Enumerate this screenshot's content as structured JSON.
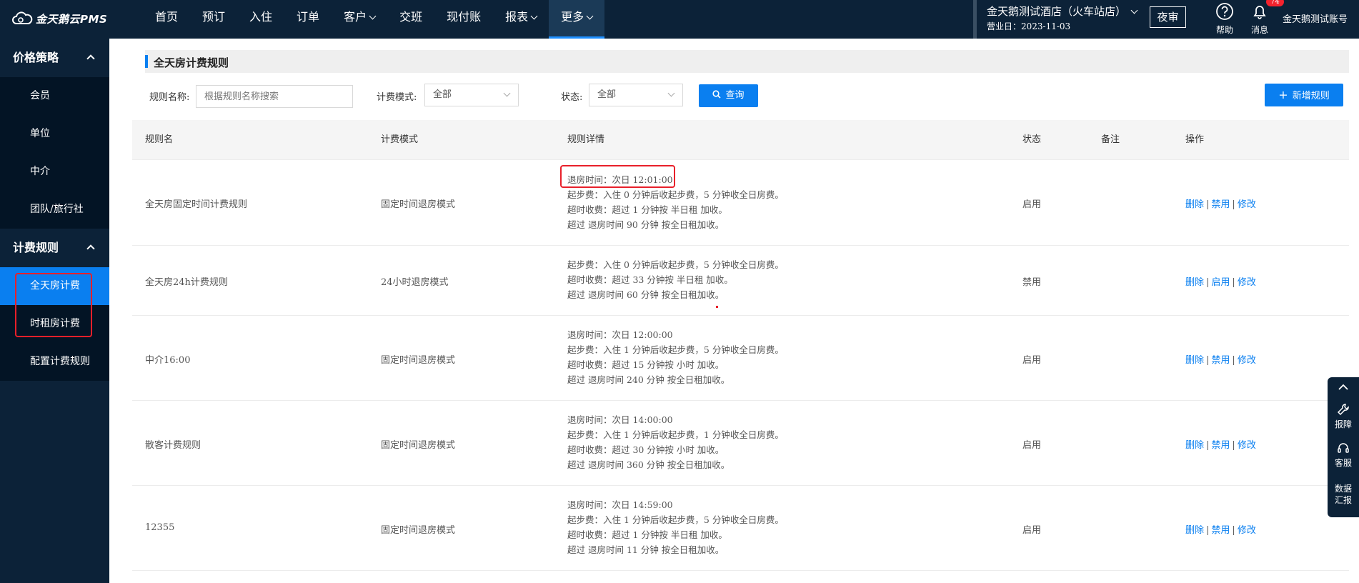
{
  "app": {
    "logo_text": "金天鹅云PMS"
  },
  "nav": {
    "items": [
      {
        "label": "首页",
        "dropdown": false,
        "active": false
      },
      {
        "label": "预订",
        "dropdown": false,
        "active": false
      },
      {
        "label": "入住",
        "dropdown": false,
        "active": false
      },
      {
        "label": "订单",
        "dropdown": false,
        "active": false
      },
      {
        "label": "客户",
        "dropdown": true,
        "active": false
      },
      {
        "label": "交班",
        "dropdown": false,
        "active": false
      },
      {
        "label": "现付账",
        "dropdown": false,
        "active": false
      },
      {
        "label": "报表",
        "dropdown": true,
        "active": false
      },
      {
        "label": "更多",
        "dropdown": true,
        "active": true
      }
    ]
  },
  "header": {
    "hotel_name": "金天鹅测试酒店（火车站店）",
    "business_date": "营业日：2023-11-03",
    "night_audit": "夜审",
    "help": "帮助",
    "messages": "消息",
    "message_badge": "74",
    "user": "金天鹅测试账号"
  },
  "sidebar": {
    "group1": "价格策略",
    "group1_items": [
      "会员",
      "单位",
      "中介",
      "团队/旅行社"
    ],
    "group2": "计费规则",
    "group2_items": [
      "全天房计费",
      "时租房计费",
      "配置计费规则"
    ],
    "active_item": "全天房计费"
  },
  "page": {
    "title": "全天房计费规则"
  },
  "filters": {
    "name_label": "规则名称:",
    "name_placeholder": "根据规则名称搜索",
    "mode_label": "计费模式:",
    "mode_value": "全部",
    "status_label": "状态:",
    "status_value": "全部",
    "query_button": "查询",
    "add_button": "新增规则"
  },
  "table": {
    "columns": [
      "规则名",
      "计费模式",
      "规则详情",
      "状态",
      "备注",
      "操作"
    ],
    "rows": [
      {
        "name": "全天房固定时间计费规则",
        "mode": "固定时间退房模式",
        "details": [
          "退房时间：次日 12:01:00",
          "起步费：入住 0 分钟后收起步费，5 分钟收全日房费。",
          "超时收费：超过 1 分钟按 半日租 加收。",
          "超过 退房时间 90 分钟 按全日租加收。"
        ],
        "status": "启用",
        "note": "",
        "ops": [
          "删除",
          "禁用",
          "修改"
        ]
      },
      {
        "name": "全天房24h计费规则",
        "mode": "24小时退房模式",
        "details": [
          "起步费：入住 0 分钟后收起步费，5 分钟收全日房费。",
          "超时收费：超过 33 分钟按 半日租 加收。",
          "超过 退房时间 60 分钟 按全日租加收。"
        ],
        "status": "禁用",
        "note": "",
        "ops": [
          "删除",
          "启用",
          "修改"
        ]
      },
      {
        "name": "中介16:00",
        "mode": "固定时间退房模式",
        "details": [
          "退房时间：次日 12:00:00",
          "起步费：入住 1 分钟后收起步费，5 分钟收全日房费。",
          "超时收费：超过 15 分钟按 小时 加收。",
          "超过 退房时间 240 分钟 按全日租加收。"
        ],
        "status": "启用",
        "note": "",
        "ops": [
          "删除",
          "禁用",
          "修改"
        ]
      },
      {
        "name": "散客计费规则",
        "mode": "固定时间退房模式",
        "details": [
          "退房时间：次日 14:00:00",
          "起步费：入住 1 分钟后收起步费，1 分钟收全日房费。",
          "超时收费：超过 30 分钟按 小时 加收。",
          "超过 退房时间 360 分钟 按全日租加收。"
        ],
        "status": "启用",
        "note": "",
        "ops": [
          "删除",
          "禁用",
          "修改"
        ]
      },
      {
        "name": "12355",
        "mode": "固定时间退房模式",
        "details": [
          "退房时间：次日 14:59:00",
          "起步费：入住 1 分钟后收起步费，5 分钟收全日房费。",
          "超时收费：超过 1 分钟按 半日租 加收。",
          "超过 退房时间 11 分钟 按全日租加收。"
        ],
        "status": "启用",
        "note": "",
        "ops": [
          "删除",
          "禁用",
          "修改"
        ]
      }
    ]
  },
  "float_panel": {
    "report": "报障",
    "service": "客服",
    "data_line1": "数据",
    "data_line2": "汇报"
  },
  "colors": {
    "nav_bg": "#0c2238",
    "accent": "#0a7ff0",
    "highlight": "#e8202a"
  }
}
